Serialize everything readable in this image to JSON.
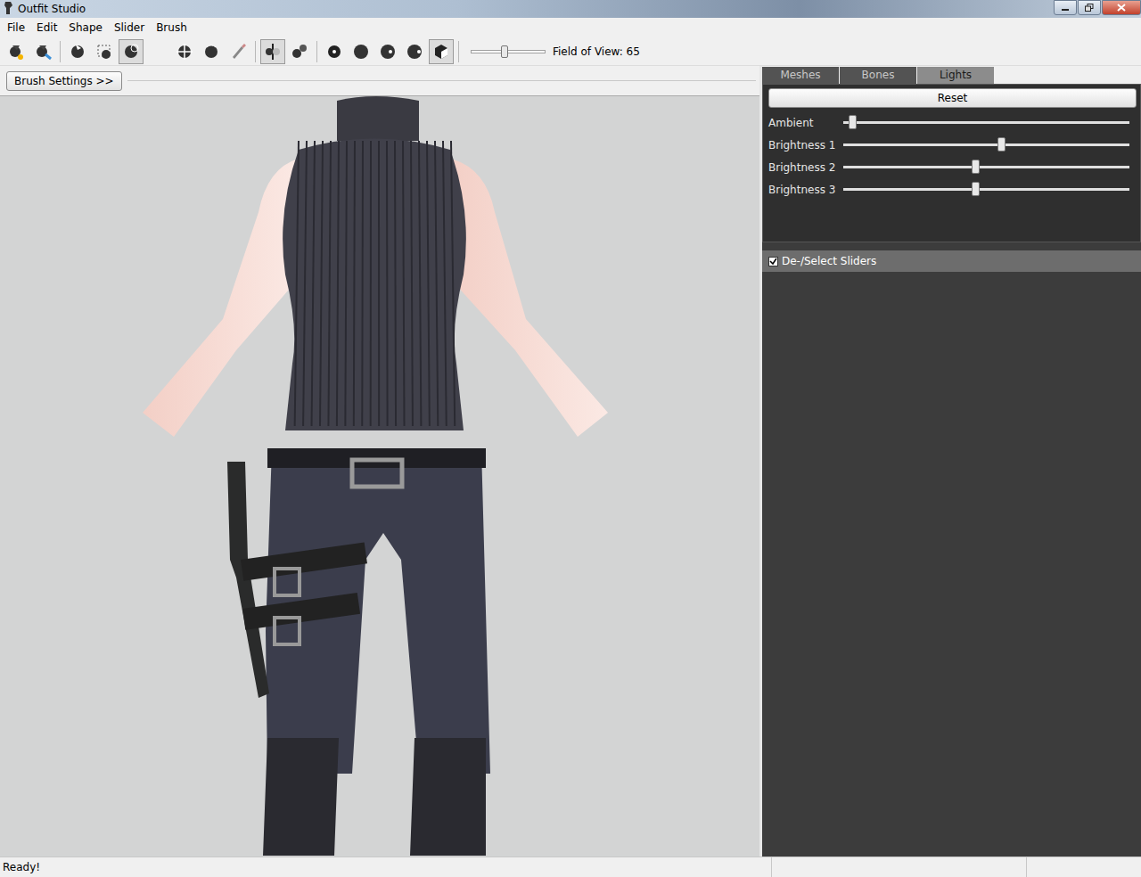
{
  "window": {
    "title": "Outfit Studio"
  },
  "menu": [
    "File",
    "Edit",
    "Shape",
    "Slider",
    "Brush"
  ],
  "toolbar": {
    "tools": [
      {
        "selected": false
      },
      {
        "selected": false
      },
      {
        "selected": false
      },
      {
        "selected": false
      },
      {
        "selected": true
      },
      {
        "selected": false
      },
      {
        "selected": false
      },
      {
        "selected": false
      },
      {
        "selected": false
      },
      {
        "selected": true
      },
      {
        "selected": false
      },
      {
        "selected": false
      },
      {
        "selected": false
      },
      {
        "selected": false
      },
      {
        "selected": false
      },
      {
        "selected": true
      }
    ],
    "fov": {
      "label": "Field of View: 65",
      "level": 0.45
    }
  },
  "brush_settings": "Brush Settings >>",
  "tabs": [
    {
      "label": "Meshes",
      "selected": false
    },
    {
      "label": "Bones",
      "selected": false
    },
    {
      "label": "Lights",
      "selected": true
    }
  ],
  "lights": {
    "reset": "Reset",
    "sliders": [
      {
        "label": "Ambient",
        "level": 0.02
      },
      {
        "label": "Brightness 1",
        "level": 0.54
      },
      {
        "label": "Brightness 2",
        "level": 0.45
      },
      {
        "label": "Brightness 3",
        "level": 0.45
      }
    ]
  },
  "sliders_header": {
    "label": "De-/Select Sliders",
    "checked": true
  },
  "status_bar": {
    "text": "Ready!"
  }
}
